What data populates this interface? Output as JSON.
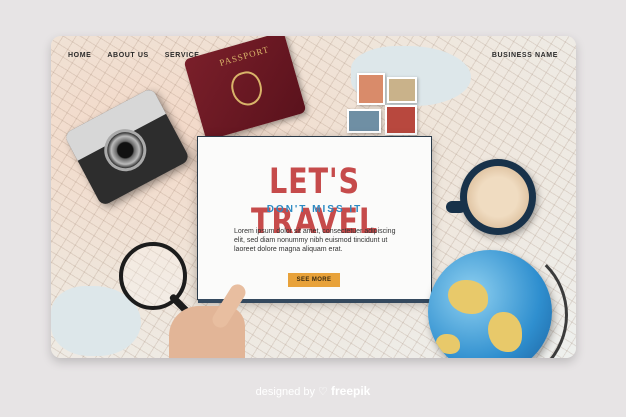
{
  "nav": {
    "items": [
      "HOME",
      "ABOUT US",
      "SERVICE"
    ],
    "business_name": "BUSINESS NAME"
  },
  "passport": {
    "label": "PASSPORT"
  },
  "hero": {
    "headline": "LET'S TRAVEL",
    "subheadline": "DON'T MISS IT",
    "body": "Lorem ipsum dolor sit amet, consectetuer adipiscing elit, sed diam nonummy nibh euismod tincidunt ut laoreet dolore magna aliquam erat.",
    "cta_label": "SEE MORE"
  },
  "footer": {
    "credit_prefix": "designed by",
    "credit_brand": "freepik"
  },
  "colors": {
    "headline": "#c64b4b",
    "subheadline": "#2c8ac3",
    "cta": "#e8a23a",
    "page_background": "#e7e4e5"
  }
}
